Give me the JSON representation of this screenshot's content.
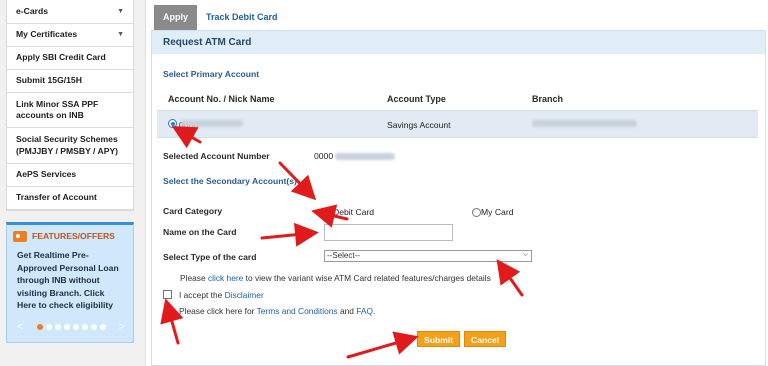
{
  "sidebar": {
    "items": [
      {
        "label": "e-Cards",
        "caret": "▼"
      },
      {
        "label": "My Certificates",
        "caret": "▼"
      },
      {
        "label": "Apply SBI Credit Card",
        "caret": ""
      },
      {
        "label": "Submit 15G/15H",
        "caret": ""
      },
      {
        "label": "Link Minor SSA PPF accounts on INB",
        "caret": ""
      },
      {
        "label": "Social Security Schemes (PMJJBY / PMSBY / APY)",
        "caret": ""
      },
      {
        "label": "AePS Services",
        "caret": ""
      },
      {
        "label": "Transfer of Account",
        "caret": ""
      }
    ],
    "promo": {
      "title": "FEATURES/OFFERS",
      "text": "Get Realtime Pre-Approved Personal Loan through INB without visiting Branch. Click Here to check eligibility",
      "prev": "<",
      "next": ">"
    }
  },
  "tabs": [
    {
      "label": "Apply",
      "active": true
    },
    {
      "label": "Track Debit Card",
      "active": false
    }
  ],
  "form": {
    "title": "Request ATM Card",
    "primary_section": "Select Primary Account",
    "columns": [
      "Account No. / Nick Name",
      "Account Type",
      "Branch"
    ],
    "row": {
      "account_no": "0000",
      "account_type": "Savings Account"
    },
    "selected_account_label": "Selected Account Number",
    "selected_account_value": "0000",
    "secondary_section": "Select the Secondary Account(s)",
    "card_category_label": "Card Category",
    "card_options": [
      "Debit Card",
      "My Card"
    ],
    "name_on_card_label": "Name on the Card",
    "card_type_label": "Select Type of the card",
    "card_type_value": "--Select--",
    "variant_note_pre": "Please",
    "variant_note_link": "click here",
    "variant_note_post": "to view the variant wise ATM Card related features/charges details",
    "accept_pre": "I accept the",
    "accept_link": "Disclaimer",
    "terms_pre": "Please click here for",
    "terms_link": "Terms and Conditions",
    "terms_and": "and",
    "faq_link": "FAQ.",
    "submit_label": "Submit",
    "cancel_label": "Cancel"
  },
  "colors": {
    "accent": "#2b5b92",
    "button": "#f5a018",
    "annotation": "#e11b1b"
  }
}
